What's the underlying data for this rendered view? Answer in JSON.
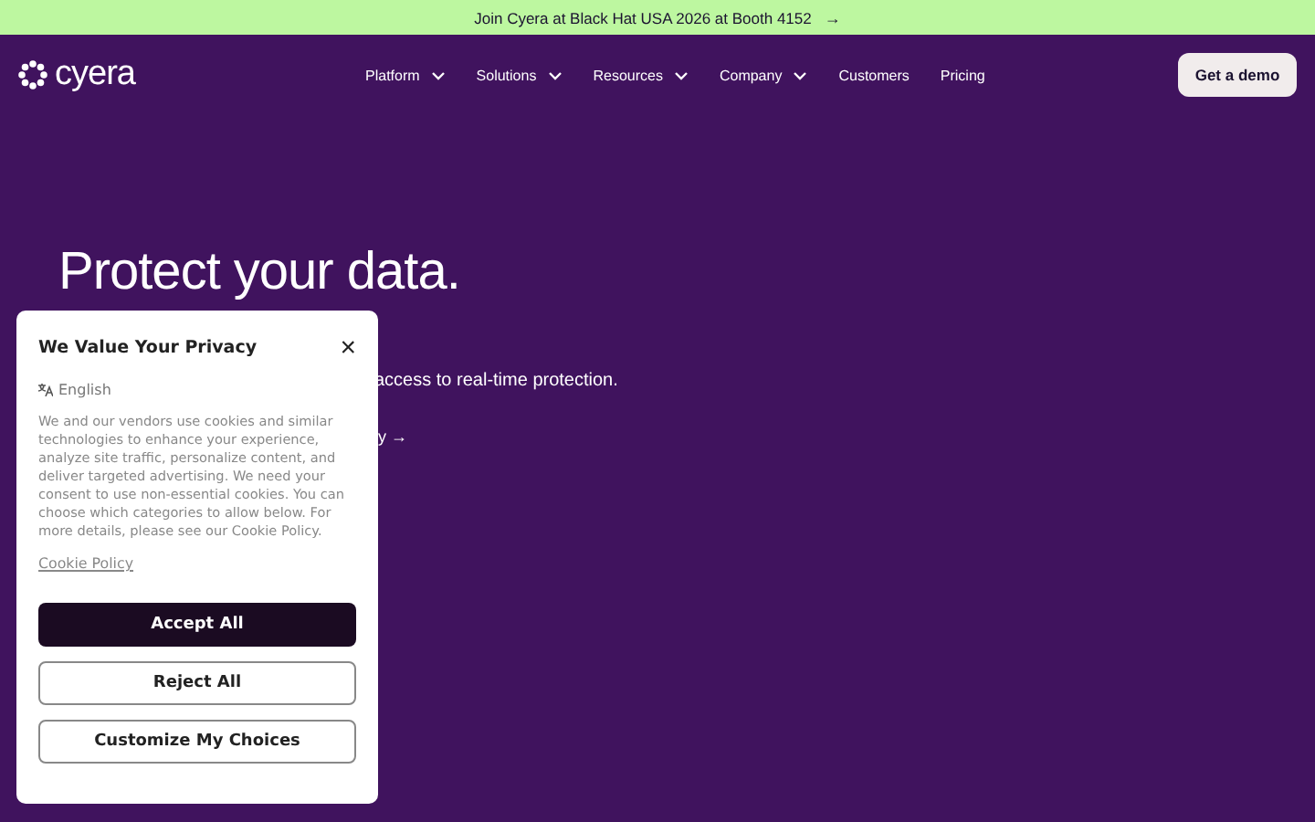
{
  "announcement": {
    "text": "Join Cyera at Black Hat USA 2026 at Booth 4152",
    "arrow": "→"
  },
  "nav": {
    "logo": "cyera",
    "items": [
      {
        "label": "Platform",
        "dropdown": true
      },
      {
        "label": "Solutions",
        "dropdown": true
      },
      {
        "label": "Resources",
        "dropdown": true
      },
      {
        "label": "Company",
        "dropdown": true
      },
      {
        "label": "Customers",
        "dropdown": false
      },
      {
        "label": "Pricing",
        "dropdown": false
      }
    ],
    "cta": "Get a demo"
  },
  "hero": {
    "title": "Protect your data.",
    "subtitle": "access to real-time protection.",
    "link": "y →"
  },
  "cookie_dialog": {
    "title": "We Value Your Privacy",
    "close": "×",
    "language": "English",
    "body": "We and our vendors use cookies and similar technologies to enhance your experience, analyze site traffic, personalize content, and deliver targeted advertising. We need your consent to use non-essential cookies. You can choose which categories to allow below. For more details, please see our Cookie Policy.",
    "policy_link": "Cookie Policy",
    "buttons": [
      {
        "label": "Accept All",
        "kind": "primary"
      },
      {
        "label": "Reject All",
        "kind": "outline"
      },
      {
        "label": "Customize My Choices",
        "kind": "outline"
      }
    ]
  }
}
